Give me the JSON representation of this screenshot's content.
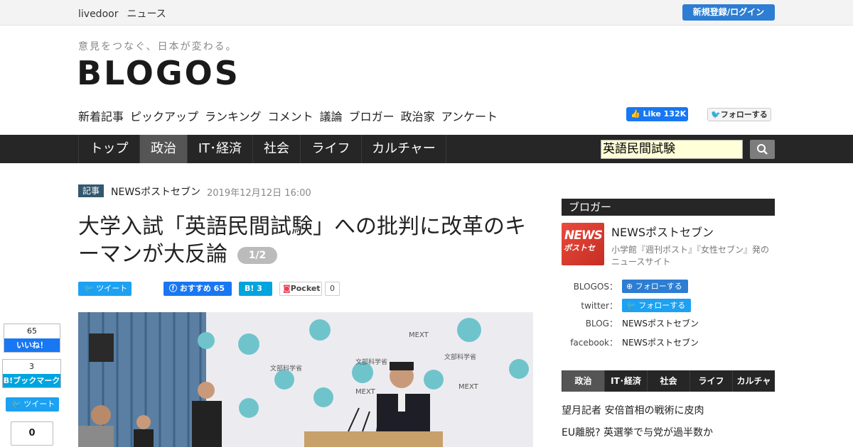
{
  "topbar": {
    "brand_a": "livedoor",
    "brand_b": "ニュース",
    "login_label": "新規登録/ログイン"
  },
  "header": {
    "tagline": "意見をつなぐ、日本が変わる。",
    "logo": "BLOGOS",
    "subnav": [
      "新着記事",
      "ピックアップ",
      "ランキング",
      "コメント",
      "議論",
      "ブロガー",
      "政治家",
      "アンケート"
    ],
    "fb_like_label": "Like 132K",
    "tw_follow_label": "フォローする"
  },
  "mainnav": {
    "items": [
      "トップ",
      "政治",
      "IT･経済",
      "社会",
      "ライフ",
      "カルチャー"
    ],
    "active": "政治",
    "search_value": "英語民間試験"
  },
  "article": {
    "badge": "記事",
    "source": "NEWSポストセブン",
    "date": "2019年12月12日 16:00",
    "title": "大学入試「英語民間試験」への批判に改革のキーマンが大反論",
    "page": "1/2",
    "share": {
      "tweet": "ツイート",
      "fb": "おすすめ 65",
      "hatena": "3",
      "pocket": "Pocket",
      "pocket_count": "0"
    }
  },
  "float_share": {
    "fb_count": "65",
    "fb_label": "いいね！",
    "hb_count": "3",
    "hb_label": "B!ブックマーク",
    "tweet": "ツイート",
    "pocket_count": "0"
  },
  "sidebar": {
    "heading": "ブロガー",
    "avatar_line1": "NEWS",
    "avatar_line2": "ポストセ",
    "name": "NEWSポストセブン",
    "description": "小学館『週刊ポスト』『女性セブン』発のニュースサイト",
    "rows": [
      {
        "label": "BLOGOS：",
        "value": "フォローする",
        "kind": "follow"
      },
      {
        "label": "twitter：",
        "value": "フォローする",
        "kind": "twfollow"
      },
      {
        "label": "BLOG：",
        "value": "NEWSポストセブン",
        "kind": "text"
      },
      {
        "label": "facebook：",
        "value": "NEWSポストセブン",
        "kind": "text"
      }
    ],
    "tabs": [
      "政治",
      "IT･経済",
      "社会",
      "ライフ",
      "カルチャー"
    ],
    "news": [
      "望月記者 安倍首相の戦術に皮肉",
      "EU離脱? 英選挙で与党が過半数か"
    ]
  },
  "photo": {
    "mext": "MEXT",
    "ministry": "文部科学省"
  },
  "colors": {
    "accent": "#2d7dd2",
    "nav_bg": "#262626",
    "twitter": "#1da1f2",
    "facebook": "#1877f2",
    "hatena": "#00a4de"
  }
}
